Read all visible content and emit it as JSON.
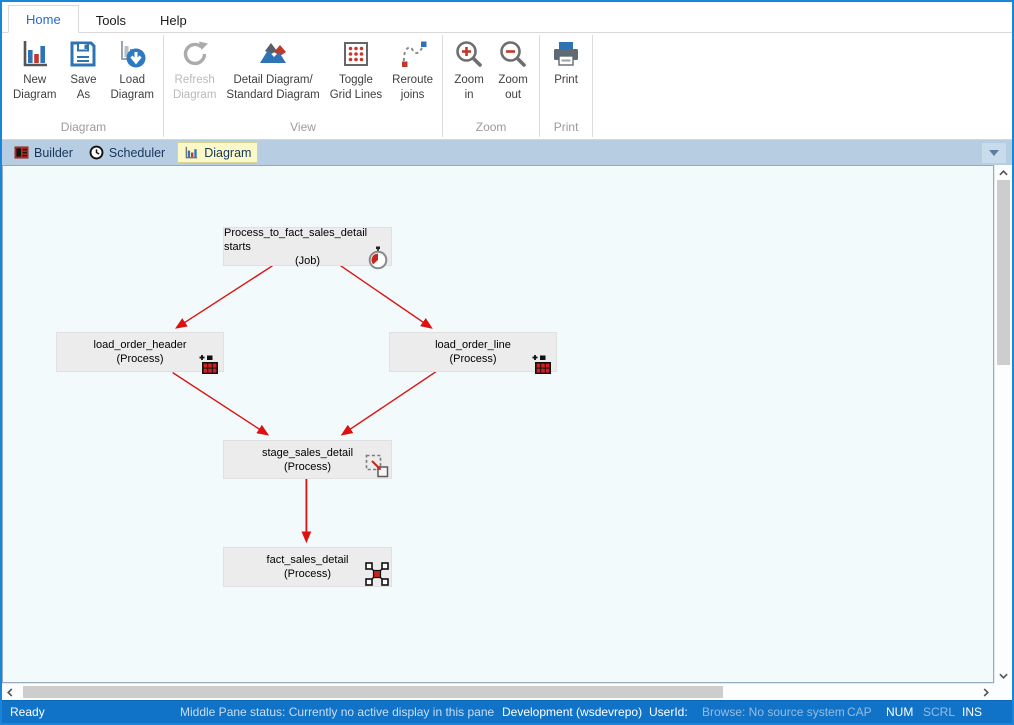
{
  "ribbon": {
    "tabs": [
      {
        "label": "Home",
        "selected": true
      },
      {
        "label": "Tools"
      },
      {
        "label": "Help"
      }
    ],
    "groups": [
      {
        "label": "Diagram",
        "buttons": [
          {
            "label": "New\nDiagram"
          },
          {
            "label": "Save\nAs"
          },
          {
            "label": "Load\nDiagram"
          }
        ]
      },
      {
        "label": "View",
        "buttons": [
          {
            "label": "Refresh\nDiagram",
            "disabled": true
          },
          {
            "label": "Detail Diagram/\nStandard Diagram"
          },
          {
            "label": "Toggle\nGrid Lines"
          },
          {
            "label": "Reroute\njoins"
          }
        ]
      },
      {
        "label": "Zoom",
        "buttons": [
          {
            "label": "Zoom\nin"
          },
          {
            "label": "Zoom\nout"
          }
        ]
      },
      {
        "label": "Print",
        "buttons": [
          {
            "label": "Print"
          }
        ]
      }
    ]
  },
  "doc_tabs": [
    {
      "label": "Builder",
      "icon": "builder-icon"
    },
    {
      "label": "Scheduler",
      "icon": "scheduler-icon"
    },
    {
      "label": "Diagram",
      "icon": "diagram-icon",
      "selected": true
    }
  ],
  "diagram": {
    "edge_color": "#dd1111",
    "node_background": "#ececec",
    "canvas_background": "#f2fafc",
    "nodes": [
      {
        "name": "Process_to_fact_sales_detail starts",
        "type": "(Job)",
        "icon": "stopwatch-icon"
      },
      {
        "name": "load_order_header",
        "type": "(Process)",
        "icon": "load-table-icon"
      },
      {
        "name": "load_order_line",
        "type": "(Process)",
        "icon": "load-table-icon"
      },
      {
        "name": "stage_sales_detail",
        "type": "(Process)",
        "icon": "stage-table-icon"
      },
      {
        "name": "fact_sales_detail",
        "type": "(Process)",
        "icon": "fact-table-icon"
      }
    ]
  },
  "status_bar": {
    "ready": "Ready",
    "middle_pane": "Middle Pane status: Currently no active display in this pane",
    "repository": "Development (wsdevrepo)",
    "userid_label": "UserId:",
    "browse": "Browse: No source system",
    "cap": "CAP",
    "num": "NUM",
    "scrl": "SCRL",
    "ins": "INS"
  },
  "colors": {
    "window_border": "#1887da",
    "accent_blue": "#2e74b5",
    "accent_red": "#c0392b",
    "selected_tab_yellow": "#fcf9c8",
    "doc_tab_bar": "#b7cde1",
    "status_bar": "#1173c7"
  }
}
